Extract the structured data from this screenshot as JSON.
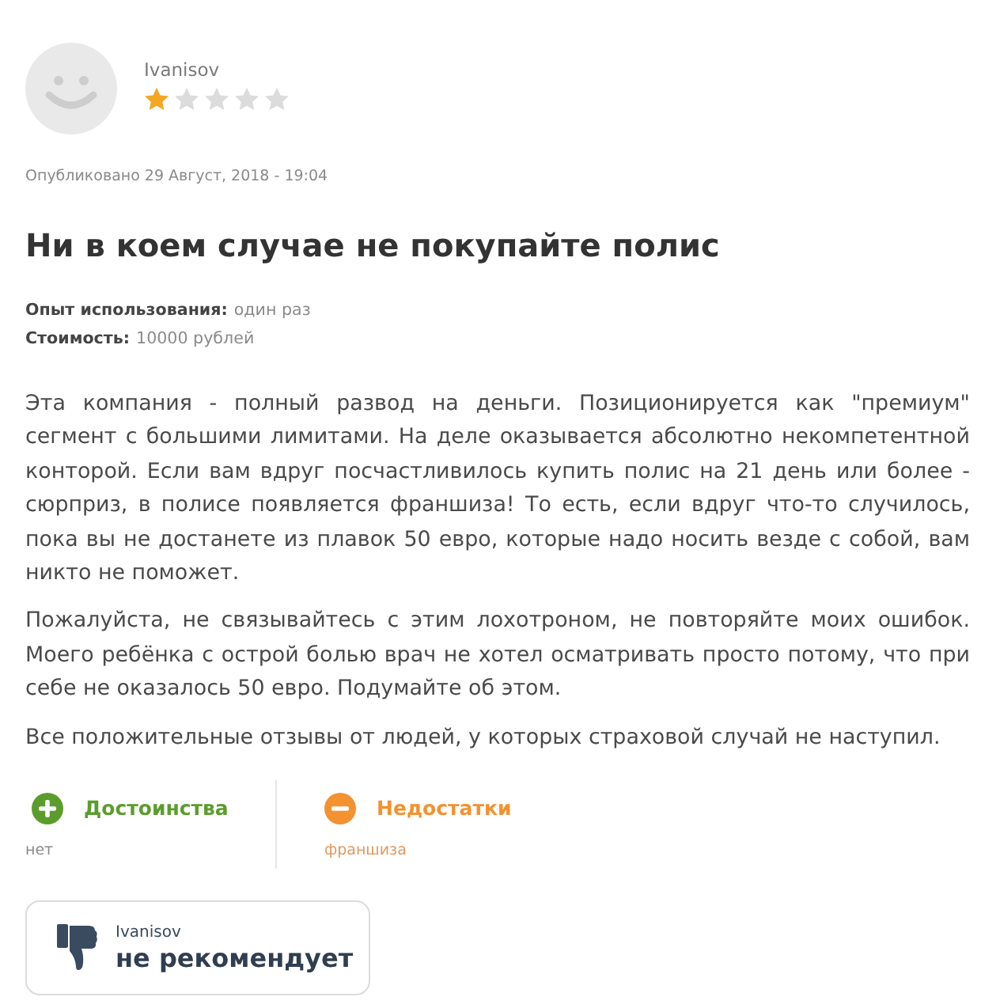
{
  "review": {
    "author": {
      "name": "Ivanisov",
      "stars": 1
    },
    "published": "Опубликовано 29 Август, 2018 - 19:04",
    "title": "Ни в коем случае не покупайте полис",
    "details": [
      {
        "label": "Опыт использования:",
        "value": "один раз"
      },
      {
        "label": "Стоимость:",
        "value": "10000 рублей"
      }
    ],
    "paragraphs": [
      "Эта компания - полный развод на деньги. Позиционируется как \"премиум\" сегмент с большими лимитами. На деле оказывается абсолютно некомпетентной конторой. Если вам вдруг посчастливилось купить полис на 21 день или более - сюрприз, в полисе появляется франшиза! То есть, если вдруг что-то случилось, пока вы не достанете из плавок 50 евро, которые надо носить везде с собой, вам никто не поможет.",
      "Пожалуйста, не связывайтесь с этим лохотроном, не повторяйте моих ошибок. Моего ребёнка с острой болью врач не хотел осматривать просто потому, что при себе не оказалось 50 евро. Подумайте об этом.",
      "Все положительные отзывы от людей, у которых страховой случай не наступил."
    ],
    "pros_cons": [
      {
        "kind": "pros",
        "heading": "Достоинства",
        "text": "нет"
      },
      {
        "kind": "cons",
        "heading": "Недостатки",
        "text": "франшиза"
      }
    ],
    "verdict": {
      "author": "Ivanisov",
      "text": "не рекомендует",
      "recommends": false
    }
  }
}
